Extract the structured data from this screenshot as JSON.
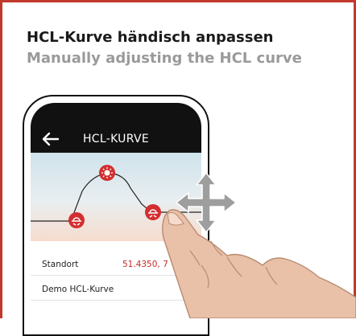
{
  "heading": {
    "title_de": "HCL-Kurve händisch anpassen",
    "title_en": "Manually adjusting the HCL curve"
  },
  "app": {
    "screen_title": "HCL-KURVE",
    "rows": [
      {
        "label": "Standort",
        "value": "51.4350, 7"
      },
      {
        "label": "Demo HCL-Kurve",
        "value": ""
      }
    ]
  },
  "icons": {
    "back": "arrow-left-icon",
    "curve_points": [
      "sunrise-icon",
      "sun-icon",
      "sunset-icon"
    ],
    "gesture": "move-arrows-icon"
  },
  "colors": {
    "frame": "#c0392b",
    "accent_red": "#c62828",
    "appbar": "#111111",
    "title": "#1a1a1a",
    "subtitle": "#9a9a9a"
  }
}
